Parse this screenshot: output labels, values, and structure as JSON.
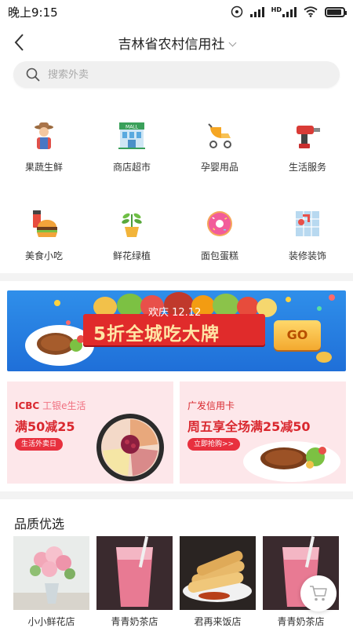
{
  "status_bar": {
    "time": "晚上9:15",
    "network": "HD",
    "battery": 0.9
  },
  "header": {
    "title": "吉林省农村信用社"
  },
  "search": {
    "placeholder": "搜索外卖"
  },
  "categories": [
    {
      "label": "果蔬生鲜",
      "icon": "farmer-icon"
    },
    {
      "label": "商店超市",
      "icon": "mall-icon"
    },
    {
      "label": "孕婴用品",
      "icon": "stroller-icon"
    },
    {
      "label": "生活服务",
      "icon": "drill-icon"
    },
    {
      "label": "美食小吃",
      "icon": "burger-icon"
    },
    {
      "label": "鲜花绿植",
      "icon": "plant-icon"
    },
    {
      "label": "面包蛋糕",
      "icon": "donut-icon"
    },
    {
      "label": "装修装饰",
      "icon": "shower-icon"
    }
  ],
  "banner": {
    "subtitle": "欢庆 12.12",
    "headline": "5折全城吃大牌",
    "button": "GO"
  },
  "promos": [
    {
      "bank": "ICBC",
      "bank_name": "工银e生活",
      "offer": "满50减25",
      "tag": "生活外卖日"
    },
    {
      "bank": "",
      "bank_name": "广发信用卡",
      "offer": "周五享全场满25减50",
      "tag": "立即抢购>>"
    }
  ],
  "section": {
    "title": "品质优选"
  },
  "products": [
    {
      "name": "小小鲜花店",
      "image": "flowers"
    },
    {
      "name": "青青奶茶店",
      "image": "pink-drink"
    },
    {
      "name": "君再来饭店",
      "image": "fried-rolls"
    },
    {
      "name": "青青奶茶店",
      "image": "pink-drink"
    }
  ],
  "colors": {
    "accent_red": "#d9282f",
    "banner_blue": "#1f6fd8",
    "promo_bg": "#fde7ea"
  }
}
